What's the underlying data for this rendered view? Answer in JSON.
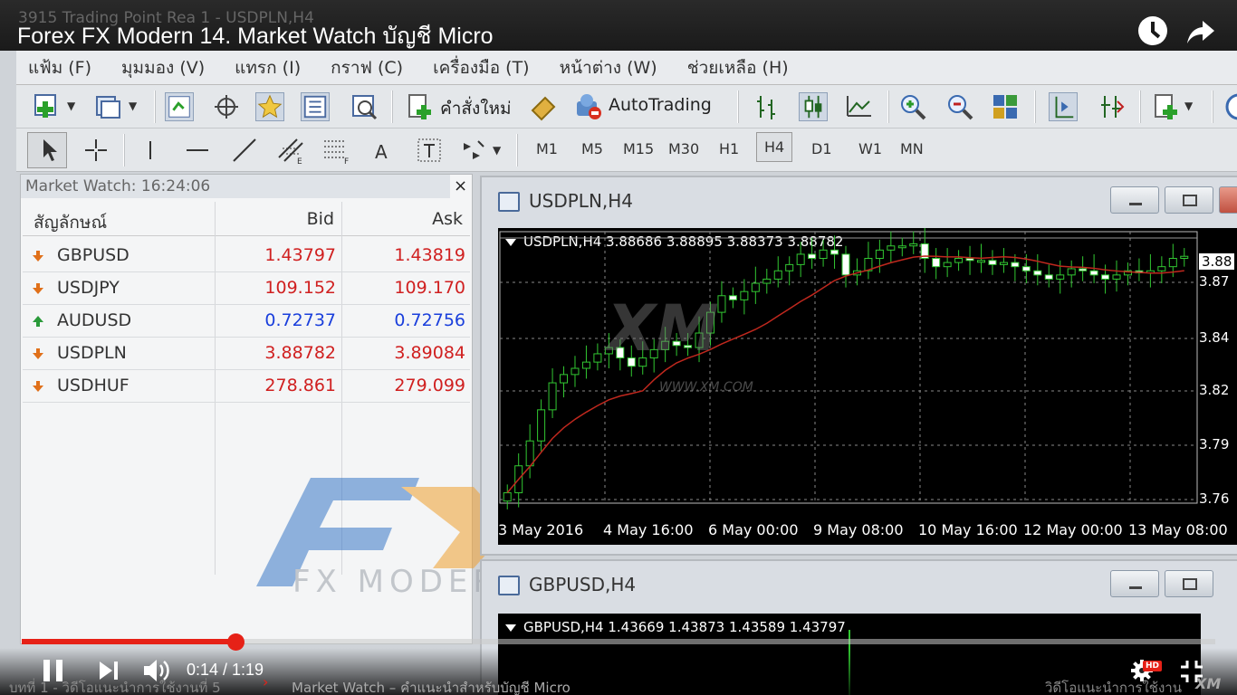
{
  "video": {
    "title": "Forex FX Modern 14. Market Watch บัญชี Micro",
    "window_ghost_title": "3915 Trading Point Rea 1 - USDPLN,H4",
    "time": "0:14 / 1:19",
    "progress_fraction": 0.18,
    "hd_badge": "HD",
    "bottom_left": "บทที่ 1 - วิดีโอแนะนำการใช้งานที่ 5",
    "bottom_mid": "Market Watch – คำแนะนำสำหรับบัญชี Micro",
    "bottom_right": "วิดีโอแนะนำการใช้งาน",
    "bottom_brand": "XM"
  },
  "menu": [
    "แฟ้ม (F)",
    "มุมมอง (V)",
    "แทรก (I)",
    "กราฟ (C)",
    "เครื่องมือ (T)",
    "หน้าต่าง (W)",
    "ช่วยเหลือ (H)"
  ],
  "toolbar": {
    "new_order": "คำสั่งใหม่",
    "autotrading": "AutoTrading",
    "timeframes": [
      "M1",
      "M5",
      "M15",
      "M30",
      "H1",
      "H4",
      "D1",
      "W1",
      "MN"
    ],
    "selected_timeframe": "H4",
    "text_tool": "A"
  },
  "market_watch": {
    "title": "Market Watch: 16:24:06",
    "close": "×",
    "headers": {
      "symbol": "สัญลักษณ์",
      "bid": "Bid",
      "ask": "Ask"
    },
    "rows": [
      {
        "symbol": "GBPUSD",
        "bid": "1.43797",
        "ask": "1.43819",
        "dir": "down",
        "color": "#d02020"
      },
      {
        "symbol": "USDJPY",
        "bid": "109.152",
        "ask": "109.170",
        "dir": "down",
        "color": "#d02020"
      },
      {
        "symbol": "AUDUSD",
        "bid": "0.72737",
        "ask": "0.72756",
        "dir": "up",
        "color": "#1a3fdc"
      },
      {
        "symbol": "USDPLN",
        "bid": "3.88782",
        "ask": "3.89084",
        "dir": "down",
        "color": "#d02020"
      },
      {
        "symbol": "USDHUF",
        "bid": "278.861",
        "ask": "279.099",
        "dir": "down",
        "color": "#d02020"
      }
    ],
    "watermark": "FX MODERN"
  },
  "charts": [
    {
      "window_title": "USDPLN,H4",
      "header": "USDPLN,H4  3.88686 3.88895 3.88373 3.88782",
      "x_labels": [
        "3 May 2016",
        "4 May 16:00",
        "6 May 00:00",
        "9 May 08:00",
        "10 May 16:00",
        "12 May 00:00",
        "13 May 08:00"
      ],
      "y_labels": [
        "3.88",
        "3.87",
        "3.84",
        "3.82",
        "3.79",
        "3.76"
      ],
      "watermark": "XM",
      "watermark_url": "WWW.XM.COM"
    },
    {
      "window_title": "GBPUSD,H4",
      "header": "GBPUSD,H4  1.43669 1.43873 1.43589 1.43797"
    }
  ],
  "chart_data": {
    "type": "candlestick",
    "symbol": "USDPLN,H4",
    "x": [
      "3 May 2016",
      "4 May 16:00",
      "6 May 00:00",
      "9 May 08:00",
      "10 May 16:00",
      "12 May 00:00",
      "13 May 08:00"
    ],
    "ylim": [
      3.76,
      3.89
    ],
    "last_price": 3.88782,
    "close_series": [
      3.765,
      3.778,
      3.79,
      3.805,
      3.818,
      3.822,
      3.825,
      3.828,
      3.832,
      3.835,
      3.83,
      3.826,
      3.83,
      3.834,
      3.838,
      3.836,
      3.835,
      3.842,
      3.852,
      3.86,
      3.858,
      3.862,
      3.866,
      3.868,
      3.872,
      3.875,
      3.88,
      3.878,
      3.882,
      3.88,
      3.87,
      3.872,
      3.878,
      3.882,
      3.884,
      3.884,
      3.885,
      3.878,
      3.874,
      3.876,
      3.878,
      3.877,
      3.877,
      3.875,
      3.876,
      3.874,
      3.872,
      3.87,
      3.868,
      3.87,
      3.873,
      3.872,
      3.87,
      3.868,
      3.87,
      3.872,
      3.871,
      3.872,
      3.874,
      3.878,
      3.879
    ],
    "ma_color": "#c0281e",
    "bull_color": "#32c832",
    "bear_color": "#ffffff"
  }
}
